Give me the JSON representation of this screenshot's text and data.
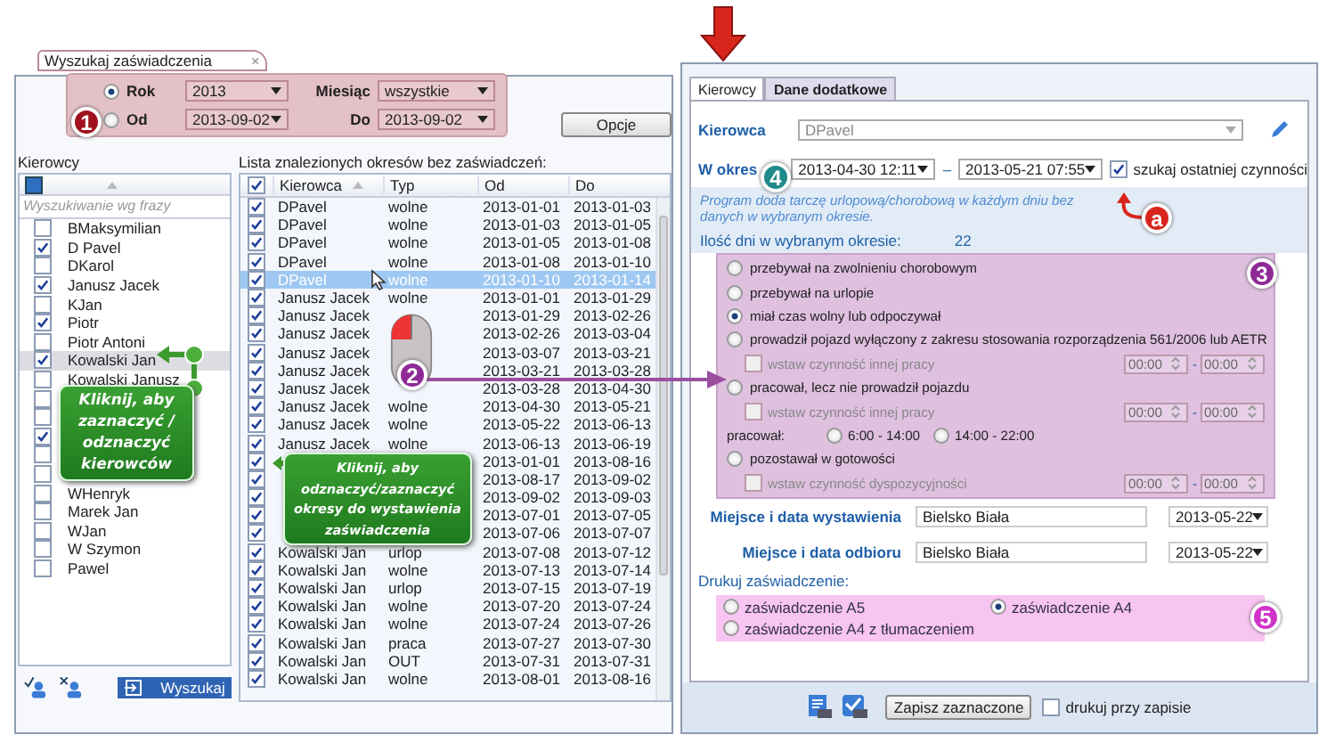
{
  "search_tab": {
    "label": "Wyszukaj zaświadczenia",
    "close": "×",
    "selected": true
  },
  "filter": {
    "marker": "1",
    "modes": [
      {
        "label": "Rok",
        "selected": true,
        "value": "2013"
      },
      {
        "label": "Od",
        "selected": false,
        "value": "2013-09-02"
      }
    ],
    "month": {
      "label": "Miesiąc",
      "value": "wszystkie"
    },
    "to": {
      "label": "Do",
      "value": "2013-09-02"
    }
  },
  "options_button": "Opcje",
  "drivers": {
    "label": "Kierowcy",
    "partially_checked": true,
    "search_placeholder": "Wyszukiwanie wg frazy",
    "callout": "Kliknij, aby zaznaczyć / odznaczyć kierowców",
    "search_button": "Wyszukaj",
    "items": [
      {
        "name": "BMaksymilian",
        "checked": false,
        "selected": false
      },
      {
        "name": "D Pavel",
        "checked": true,
        "selected": false
      },
      {
        "name": "DKarol",
        "checked": false,
        "selected": false
      },
      {
        "name": "Janusz Jacek",
        "checked": true,
        "selected": false
      },
      {
        "name": "KJan",
        "checked": false,
        "selected": false
      },
      {
        "name": "Piotr",
        "checked": true,
        "selected": false
      },
      {
        "name": "Piotr Antoni",
        "checked": false,
        "selected": false
      },
      {
        "name": "Kowalski Jan",
        "checked": true,
        "selected": true
      },
      {
        "name": "Kowalski Janusz",
        "checked": false,
        "selected": false
      },
      {
        "checked": false,
        "selected": false
      },
      {
        "checked": false,
        "selected": false
      },
      {
        "checked": true,
        "selected": false
      },
      {
        "checked": false,
        "selected": false
      },
      {
        "checked": false,
        "selected": false
      },
      {
        "name": "WHenryk",
        "checked": false,
        "selected": false
      },
      {
        "name": "Marek Jan",
        "checked": false,
        "selected": false
      },
      {
        "name": "WJan",
        "checked": false,
        "selected": false
      },
      {
        "name": "W Szymon",
        "checked": false,
        "selected": false
      },
      {
        "name": "Pawel",
        "checked": false,
        "selected": false
      }
    ]
  },
  "table": {
    "title": "Lista znalezionych okresów bez zaświadczeń:",
    "all_checked": true,
    "marker": "2",
    "callout": "Kliknij, aby odznaczyć/zaznaczyć okresy do wystawienia zaświadczenia",
    "columns": [
      "Kierowca",
      "Typ",
      "Od",
      "Do"
    ],
    "rows": [
      {
        "checked": true,
        "selected": false,
        "driver": "DPavel",
        "type": "wolne",
        "from": "2013-01-01",
        "to": "2013-01-03"
      },
      {
        "checked": true,
        "selected": false,
        "driver": "DPavel",
        "type": "wolne",
        "from": "2013-01-03",
        "to": "2013-01-05"
      },
      {
        "checked": true,
        "selected": false,
        "driver": "DPavel",
        "type": "wolne",
        "from": "2013-01-05",
        "to": "2013-01-08"
      },
      {
        "checked": true,
        "selected": false,
        "driver": "DPavel",
        "type": "wolne",
        "from": "2013-01-08",
        "to": "2013-01-10"
      },
      {
        "checked": true,
        "selected": true,
        "driver": "DPavel",
        "type": "wolne",
        "from": "2013-01-10",
        "to": "2013-01-14"
      },
      {
        "checked": true,
        "selected": false,
        "driver": "Janusz Jacek",
        "type": "wolne",
        "from": "2013-01-01",
        "to": "2013-01-29"
      },
      {
        "checked": true,
        "selected": false,
        "driver": "Janusz Jacek",
        "from": "2013-01-29",
        "to": "2013-02-26"
      },
      {
        "checked": true,
        "selected": false,
        "driver": "Janusz Jacek",
        "from": "2013-02-26",
        "to": "2013-03-04"
      },
      {
        "checked": true,
        "selected": false,
        "driver": "Janusz Jacek",
        "from": "2013-03-07",
        "to": "2013-03-21"
      },
      {
        "checked": true,
        "selected": false,
        "driver": "Janusz Jacek",
        "from": "2013-03-21",
        "to": "2013-03-28"
      },
      {
        "checked": true,
        "selected": false,
        "driver": "Janusz Jacek",
        "from": "2013-03-28",
        "to": "2013-04-30"
      },
      {
        "checked": true,
        "selected": false,
        "driver": "Janusz Jacek",
        "type": "wolne",
        "from": "2013-04-30",
        "to": "2013-05-21"
      },
      {
        "checked": true,
        "selected": false,
        "driver": "Janusz Jacek",
        "type": "wolne",
        "from": "2013-05-22",
        "to": "2013-06-13"
      },
      {
        "checked": true,
        "selected": false,
        "driver": "Janusz Jacek",
        "type": "wolne",
        "from": "2013-06-13",
        "to": "2013-06-19"
      },
      {
        "checked": true,
        "selected": false,
        "from": "2013-01-01",
        "to": "2013-08-16"
      },
      {
        "checked": true,
        "selected": false,
        "from": "2013-08-17",
        "to": "2013-09-02"
      },
      {
        "checked": true,
        "selected": false,
        "from": "2013-09-02",
        "to": "2013-09-03"
      },
      {
        "checked": true,
        "selected": false,
        "from": "2013-07-01",
        "to": "2013-07-05"
      },
      {
        "checked": true,
        "selected": false,
        "from": "2013-07-06",
        "to": "2013-07-07"
      },
      {
        "checked": true,
        "selected": false,
        "driver": "Kowalski Jan",
        "type": "urlop",
        "from": "2013-07-08",
        "to": "2013-07-12"
      },
      {
        "checked": true,
        "selected": false,
        "driver": "Kowalski Jan",
        "type": "wolne",
        "from": "2013-07-13",
        "to": "2013-07-14"
      },
      {
        "checked": true,
        "selected": false,
        "driver": "Kowalski Jan",
        "type": "urlop",
        "from": "2013-07-15",
        "to": "2013-07-19"
      },
      {
        "checked": true,
        "selected": false,
        "driver": "Kowalski Jan",
        "type": "wolne",
        "from": "2013-07-20",
        "to": "2013-07-24"
      },
      {
        "checked": true,
        "selected": false,
        "driver": "Kowalski Jan",
        "type": "wolne",
        "from": "2013-07-24",
        "to": "2013-07-26"
      },
      {
        "checked": true,
        "selected": false,
        "driver": "Kowalski Jan",
        "type": "praca",
        "from": "2013-07-27",
        "to": "2013-07-30"
      },
      {
        "checked": true,
        "selected": false,
        "driver": "Kowalski Jan",
        "type": "OUT",
        "from": "2013-07-31",
        "to": "2013-07-31"
      },
      {
        "checked": true,
        "selected": false,
        "driver": "Kowalski Jan",
        "type": "wolne",
        "from": "2013-08-01",
        "to": "2013-08-16"
      }
    ]
  },
  "detail_tabs": [
    {
      "label": "Kierowcy",
      "selected": true
    },
    {
      "label": "Dane dodatkowe",
      "selected": false
    }
  ],
  "driver": {
    "label": "Kierowca",
    "value": "DPavel"
  },
  "period": {
    "label": "W okres",
    "marker": "4",
    "from": "2013-04-30 12:11",
    "separator": "–",
    "to": "2013-05-21 07:55",
    "last_activity": {
      "label": "szukaj ostatniej czynności",
      "checked": true,
      "marker": "a"
    }
  },
  "info": {
    "text": "Program doda tarczę urlopową/chorobową w każdym dniu bez danych w wybranym okresie.",
    "days_label": "Ilość dni w wybranym okresie:",
    "days": "22"
  },
  "activities": {
    "marker": "3",
    "items": [
      {
        "kind": "radio",
        "label": "przebywał na zwolnieniu chorobowym",
        "selected": false
      },
      {
        "kind": "radio",
        "label": "przebywał na urlopie",
        "selected": false
      },
      {
        "kind": "radio",
        "label": "miał czas wolny lub odpoczywał",
        "selected": true
      },
      {
        "kind": "radio",
        "label": "prowadził pojazd wyłączony z zakresu stosowania rozporządzenia 561/2006 lub AETR",
        "selected": false
      },
      {
        "kind": "check",
        "label": "wstaw czynność innej pracy",
        "checked": false,
        "from": "00:00",
        "dash": "-",
        "to": "00:00"
      },
      {
        "kind": "radio",
        "label": "pracował, lecz nie prowadził pojazdu",
        "selected": false
      },
      {
        "kind": "check",
        "label": "wstaw czynność innej pracy",
        "checked": false,
        "from": "00:00",
        "dash": "-",
        "to": "00:00"
      },
      {
        "kind": "shift",
        "label": "pracował:",
        "options": [
          {
            "label": "6:00 - 14:00",
            "selected": false
          },
          {
            "label": "14:00 - 22:00",
            "selected": false
          }
        ]
      },
      {
        "kind": "radio",
        "label": "pozostawał w gotowości",
        "selected": false
      },
      {
        "kind": "check",
        "label": "wstaw czynność dyspozycyjności",
        "checked": false,
        "from": "00:00",
        "dash": "-",
        "to": "00:00"
      }
    ]
  },
  "places": [
    {
      "label": "Miejsce i data wystawienia",
      "place": "Bielsko Biała",
      "date": "2013-05-22"
    },
    {
      "label": "Miejsce i data odbioru",
      "place": "Bielsko Biała",
      "date": "2013-05-22"
    }
  ],
  "print": {
    "label": "Drukuj zaświadczenie:",
    "marker": "5",
    "options": [
      {
        "label": "zaświadczenie A5",
        "selected": false
      },
      {
        "label": "zaświadczenie A4",
        "selected": true
      },
      {
        "label": "zaświadczenie A4 z tłumaczeniem",
        "selected": false
      }
    ]
  },
  "save_button": "Zapisz zaznaczone",
  "print_on_save": {
    "label": "drukuj przy zapisie",
    "checked": false
  }
}
